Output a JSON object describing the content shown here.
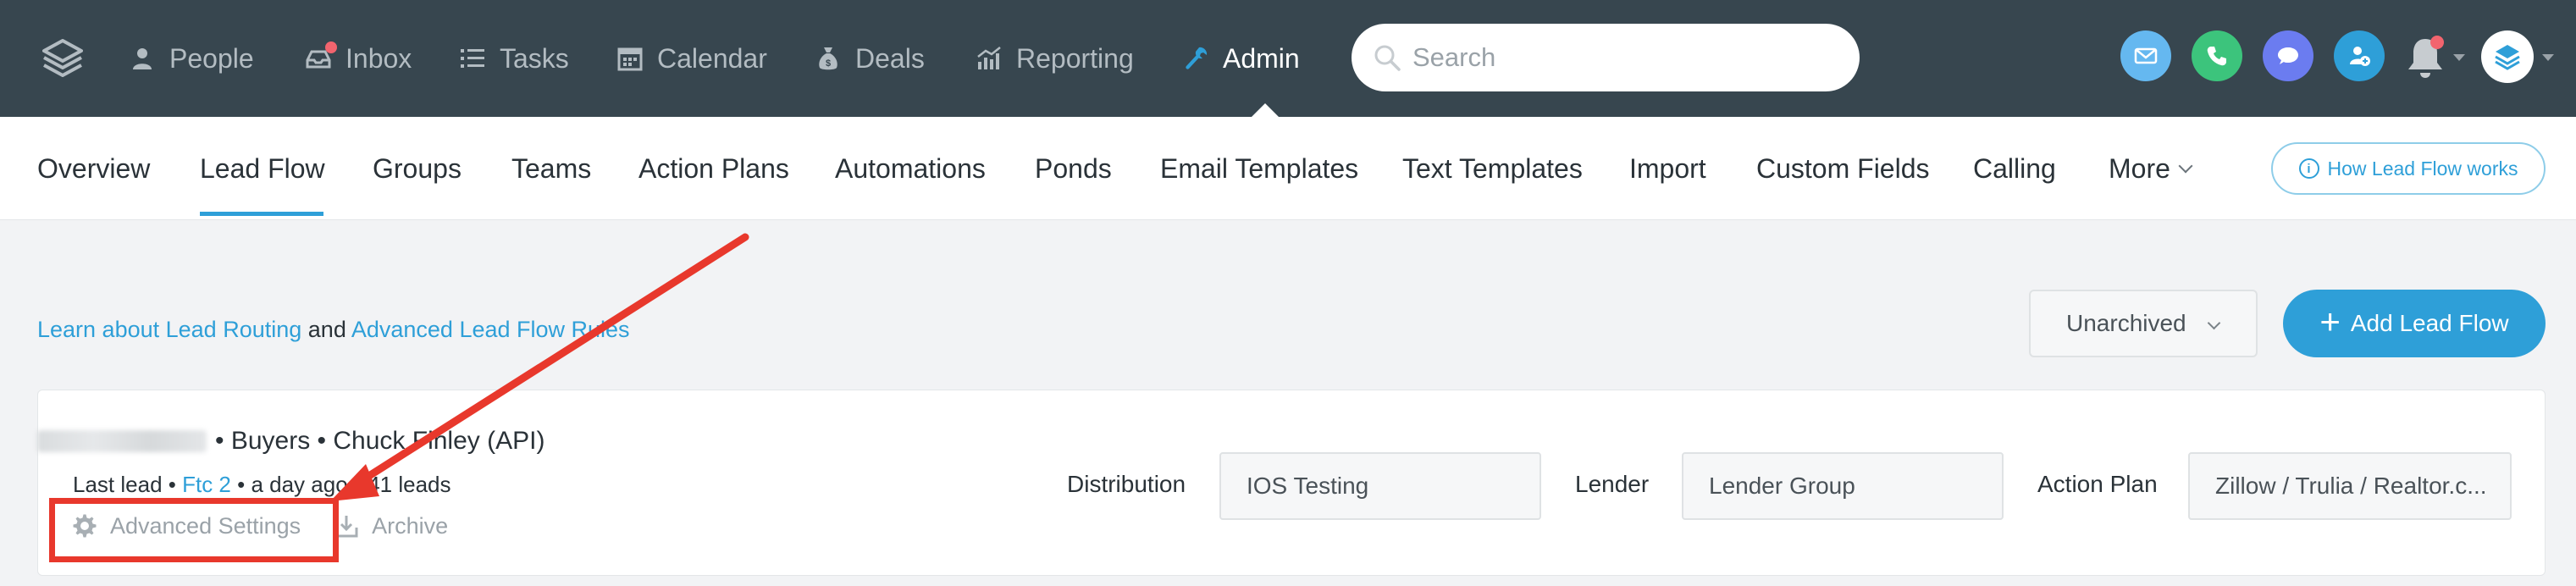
{
  "topnav": {
    "items": [
      {
        "label": "People",
        "icon": "person-icon"
      },
      {
        "label": "Inbox",
        "icon": "inbox-icon"
      },
      {
        "label": "Tasks",
        "icon": "list-icon"
      },
      {
        "label": "Calendar",
        "icon": "calendar-icon"
      },
      {
        "label": "Deals",
        "icon": "money-bag-icon"
      },
      {
        "label": "Reporting",
        "icon": "chart-icon"
      },
      {
        "label": "Admin",
        "icon": "wrench-icon",
        "active": true
      }
    ],
    "search": {
      "placeholder": "Search"
    },
    "action_buttons": [
      {
        "icon": "email-icon",
        "color": "#65b8f0"
      },
      {
        "icon": "phone-icon",
        "color": "#3cc47c"
      },
      {
        "icon": "chat-icon",
        "color": "#6b7cf0"
      },
      {
        "icon": "add-person-icon",
        "color": "#2e9fd8"
      }
    ],
    "accent": "#2e9fd8",
    "background": "#37464f"
  },
  "subnav": {
    "tabs": [
      {
        "label": "Overview"
      },
      {
        "label": "Lead Flow",
        "active": true
      },
      {
        "label": "Groups"
      },
      {
        "label": "Teams"
      },
      {
        "label": "Action Plans"
      },
      {
        "label": "Automations"
      },
      {
        "label": "Ponds"
      },
      {
        "label": "Email Templates"
      },
      {
        "label": "Text Templates"
      },
      {
        "label": "Import"
      },
      {
        "label": "Custom Fields"
      },
      {
        "label": "Calling"
      },
      {
        "label": "More"
      }
    ],
    "help_link": "How Lead Flow works"
  },
  "content": {
    "learn_prefix": "Learn about Lead Routing",
    "learn_and": "and",
    "learn_suffix": "Advanced Lead Flow Rules",
    "filter_select": "Unarchived",
    "add_button": "Add Lead Flow"
  },
  "lead_flow": {
    "title_rest": "• Buyers • Chuck Finley (API)",
    "last_lead_label": "Last lead •",
    "last_lead_link": "Ftc 2",
    "last_lead_rest": "• a day ago • 41 leads",
    "advanced_settings": "Advanced Settings",
    "archive": "Archive",
    "distribution_label": "Distribution",
    "distribution_value": "IOS Testing",
    "lender_label": "Lender",
    "lender_value": "Lender Group",
    "action_plan_label": "Action Plan",
    "action_plan_value": "Zillow / Trulia / Realtor.c..."
  },
  "annotation": {
    "color": "#e8382c"
  }
}
